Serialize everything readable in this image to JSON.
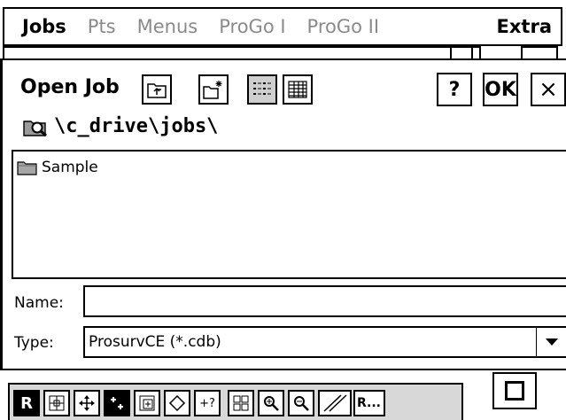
{
  "menu": {
    "items": [
      {
        "label": "Jobs",
        "active": true
      },
      {
        "label": "Pts",
        "active": false
      },
      {
        "label": "Menus",
        "active": false
      },
      {
        "label": "ProGo I",
        "active": false
      },
      {
        "label": "ProGo II",
        "active": false
      },
      {
        "label": "Extra",
        "active": true
      }
    ]
  },
  "dialog": {
    "title": "Open Job",
    "help_label": "?",
    "ok_label": "OK",
    "close_label": "×",
    "path": "\\c_drive\\jobs\\"
  },
  "files": [
    {
      "name": "Sample",
      "icon": "folder-icon"
    }
  ],
  "name_field": {
    "label": "Name:",
    "value": ""
  },
  "type_field": {
    "label": "Type:",
    "value": "ProsurvCE (*.cdb)"
  },
  "toolbar": {
    "r_label": "R",
    "question_label": "+?",
    "more_label": "R..."
  }
}
